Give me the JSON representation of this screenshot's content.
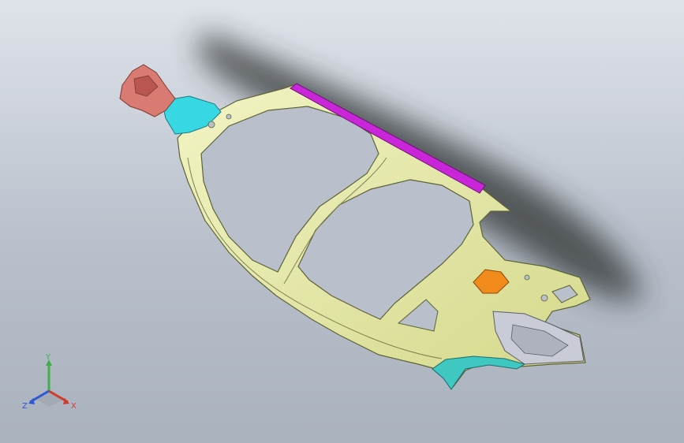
{
  "viewport": {
    "background_top": "#dfe3ea",
    "background_bottom": "#aab2be"
  },
  "model": {
    "colors": {
      "body_side": "#e7eaa6",
      "body_edge": "#5d6238",
      "roof_rail": "#c826d8",
      "hinge_pillar_bracket": "#d97b72",
      "a_pillar_reinforcement": "#37d8e4",
      "rear_bracket": "#f08b1c",
      "wheel_arch_trim": "#3fc7c2",
      "rear_panel_detail": "#c9ccd6",
      "shadow": "#2f3033"
    }
  },
  "triad": {
    "x_label": "X",
    "y_label": "Y",
    "z_label": "Z",
    "x_color": "#d43a2a",
    "y_color": "#3fb04a",
    "z_color": "#2f57d6"
  }
}
